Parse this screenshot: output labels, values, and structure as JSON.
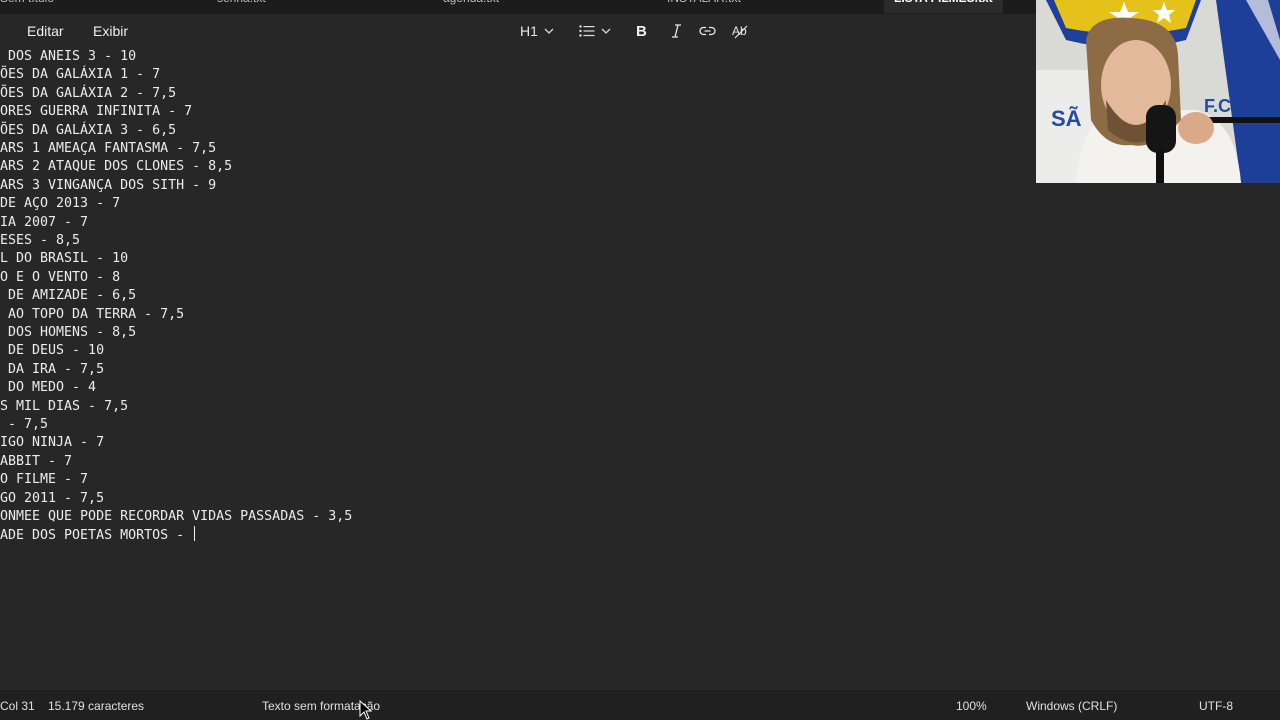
{
  "tabs": [
    {
      "label": "Sem título",
      "active": false
    },
    {
      "label": "senha.txt",
      "active": false
    },
    {
      "label": "agenda.txt",
      "active": false
    },
    {
      "label": "INSTALAR.txt",
      "active": false
    },
    {
      "label": "LISTA FILMES.txt",
      "active": true
    }
  ],
  "menu": {
    "edit": "Editar",
    "view": "Exibir"
  },
  "format_toolbar": {
    "heading": "H1",
    "icons": [
      "heading-icon",
      "list-icon",
      "bold-icon",
      "italic-icon",
      "link-icon",
      "clear-formatting-icon"
    ]
  },
  "document": {
    "lines": [
      " DOS ANEIS 3 - 10",
      "ÕES DA GALÁXIA 1 - 7",
      "ÕES DA GALÁXIA 2 - 7,5",
      "ORES GUERRA INFINITA - 7",
      "ÕES DA GALÁXIA 3 - 6,5",
      "ARS 1 AMEAÇA FANTASMA - 7,5",
      "ARS 2 ATAQUE DOS CLONES - 8,5",
      "ARS 3 VINGANÇA DOS SITH - 9",
      "DE AÇO 2013 - 7",
      "IA 2007 - 7",
      "ESES - 8,5",
      "L DO BRASIL - 10",
      "O E O VENTO - 8",
      " DE AMIZADE - 6,5",
      " AO TOPO DA TERRA - 7,5",
      " DOS HOMENS - 8,5",
      " DE DEUS - 10",
      " DA IRA - 7,5",
      " DO MEDO - 4",
      "S MIL DIAS - 7,5",
      " - 7,5",
      "IGO NINJA - 7",
      "ABBIT - 7",
      "O FILME - 7",
      "GO 2011 - 7,5",
      "ONMEE QUE PODE RECORDAR VIDAS PASSADAS - 3,5",
      "ADE DOS POETAS MORTOS - "
    ]
  },
  "status": {
    "column": "Col 31",
    "chars": "15.179 caracteres",
    "format": "Texto sem formatação",
    "zoom": "100%",
    "line_ending": "Windows (CRLF)",
    "encoding": "UTF-8"
  },
  "colors": {
    "background": "#272727",
    "statusbar": "#202020",
    "text": "#ececec"
  }
}
